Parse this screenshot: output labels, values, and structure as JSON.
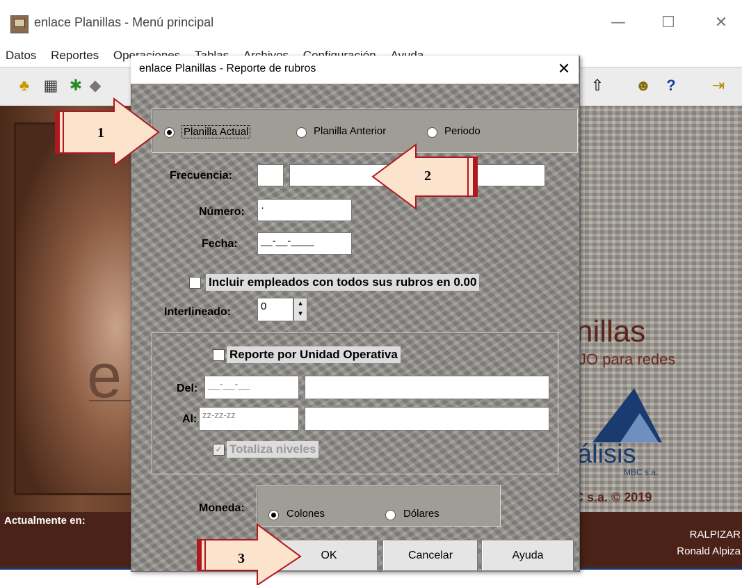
{
  "main_window": {
    "title": "enlace Planillas - Menú principal",
    "controls": {
      "minimize": "—",
      "maximize": "☐",
      "close": "✕"
    }
  },
  "menubar": [
    "Datos",
    "Reportes",
    "Operaciones",
    "Tablas",
    "Archivos",
    "Configuración",
    "Ayuda"
  ],
  "background": {
    "logo_letter": "e",
    "brand_title": "nillas",
    "brand_sub": "JO para redes",
    "company": "álisis",
    "company_sub": "MBC s.a.",
    "copyright": "C s.a. © 2019"
  },
  "status": {
    "label": "Actualmente en:",
    "user": "RALPIZAR",
    "name": "Ronald Alpiza"
  },
  "dialog": {
    "title": "enlace Planillas - Reporte de rubros",
    "close": "✕",
    "radios": [
      {
        "label": "Planilla Actual",
        "selected": true
      },
      {
        "label": "Planilla Anterior",
        "selected": false
      },
      {
        "label": "Periodo",
        "selected": false
      }
    ],
    "frecuencia_label": "Frecuencia:",
    "numero_label": "Número:",
    "numero_value": "·",
    "fecha_label": "Fecha:",
    "fecha_value": "__-__-____",
    "incluir_label": "Incluir empleados con todos sus rubros en 0.00",
    "interlineado_label": "Interlineado:",
    "interlineado_value": "0",
    "unidad_label": "Reporte por Unidad Operativa",
    "del_label": "Del:",
    "del_value": "__-__-__",
    "al_label": "Al:",
    "al_value": "zz-zz-zz",
    "totaliza_label": "Totaliza niveles",
    "moneda_label": "Moneda:",
    "moneda_options": [
      {
        "label": "Colones",
        "selected": true
      },
      {
        "label": "Dólares",
        "selected": false
      }
    ],
    "buttons": {
      "ok": "OK",
      "cancel": "Cancelar",
      "help": "Ayuda"
    }
  },
  "callouts": [
    "1",
    "2",
    "3"
  ],
  "colors": {
    "arrow_fill": "#fbe3cc",
    "arrow_stroke": "#b0171f"
  }
}
